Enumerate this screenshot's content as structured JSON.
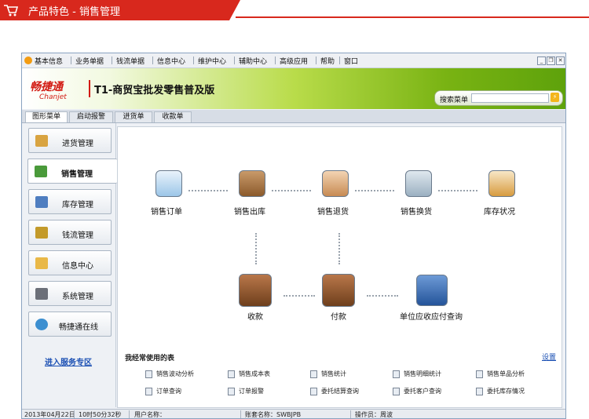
{
  "banner": {
    "title": "产品特色 - 销售管理",
    "accent_color": "#d8281d",
    "icon": "shopping-cart-icon"
  },
  "menubar": {
    "items": [
      "基本信息",
      "业务单据",
      "钱流单据",
      "信息中心",
      "维护中心",
      "辅助中心",
      "高级应用",
      "帮助",
      "窗口"
    ],
    "window_buttons": [
      "minimize-icon",
      "restore-icon",
      "close-icon"
    ]
  },
  "header": {
    "logo_cn": "畅捷通",
    "logo_en": "Chanjet",
    "product": "T1-商贸宝批发零售普及版",
    "search_label": "搜索菜单",
    "search_value": "",
    "search_button_icon": "lightning-icon"
  },
  "tabs": [
    "图形菜单",
    "启动报警",
    "进货单",
    "收款单"
  ],
  "sidebar": {
    "items": [
      {
        "label": "进货管理",
        "icon": "purchase-box-icon"
      },
      {
        "label": "销售管理",
        "icon": "shopping-basket-icon"
      },
      {
        "label": "库存管理",
        "icon": "inventory-grid-icon"
      },
      {
        "label": "钱流管理",
        "icon": "money-icon"
      },
      {
        "label": "信息中心",
        "icon": "info-bulb-icon"
      },
      {
        "label": "系统管理",
        "icon": "system-tools-icon"
      },
      {
        "label": "畅捷通在线",
        "icon": "globe-icon"
      }
    ],
    "service_link": "进入服务专区"
  },
  "flow": {
    "sales_order": "销售订单",
    "sales_out": "销售出库",
    "sales_return": "销售退货",
    "sales_exchange": "销售换货",
    "stock_status": "库存状况",
    "receive": "收款",
    "pay": "付款",
    "ar_ap_query": "单位应收应付查询"
  },
  "frequent": {
    "title": "我经常使用的表",
    "settings": "设置",
    "items": [
      "销售波动分析",
      "销售成本表",
      "销售统计",
      "销售明细统计",
      "销售单品分析",
      "订单查询",
      "订单报警",
      "委托结算查询",
      "委托客户查询",
      "委托库存情况"
    ]
  },
  "statusbar": {
    "date": "2013年04月22日",
    "time": "10时50分32秒",
    "user_name_label": "用户名称：",
    "account_name": "账套名称：SWBJPB",
    "operator": "操作员：周波"
  }
}
